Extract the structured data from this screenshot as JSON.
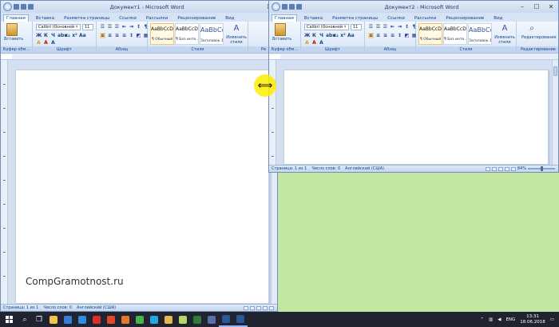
{
  "windows": [
    {
      "id": "w1",
      "title": "Документ1 - Microsoft Word",
      "tabs": [
        "Главная",
        "Вставка",
        "Разметка страницы",
        "Ссылки",
        "Рассылки",
        "Рецензирование",
        "Вид"
      ],
      "groups": {
        "clipboard": "Буфер обм...",
        "font": "Шрифт",
        "paragraph": "Абзац",
        "styles": "Стили",
        "editing": "Ре"
      },
      "paste_label": "Вставить",
      "font_name": "Calibri (Основной т",
      "font_size": "11",
      "styles": [
        {
          "sample": "AaBbCcDd",
          "name": "¶ Обычный"
        },
        {
          "sample": "AaBbCcDd",
          "name": "¶ Без инте..."
        },
        {
          "sample": "AaBbCc",
          "name": "Заголовок 1"
        }
      ],
      "change_styles": "Изменить стили",
      "status": {
        "page": "Страница: 1 из 1",
        "words": "Число слов: 0",
        "language": "Английский (США)"
      }
    },
    {
      "id": "w2",
      "title": "Документ2 - Microsoft Word",
      "tabs": [
        "Главная",
        "Вставка",
        "Разметка страницы",
        "Ссылки",
        "Рассылки",
        "Рецензирование",
        "Вид"
      ],
      "groups": {
        "clipboard": "Буфер обм...",
        "font": "Шрифт",
        "paragraph": "Абзац",
        "styles": "Стили",
        "editing": "Редактирование"
      },
      "paste_label": "Вставить",
      "font_name": "Calibri (Основной т",
      "font_size": "11",
      "styles": [
        {
          "sample": "AaBbCcDd",
          "name": "¶ Обычный"
        },
        {
          "sample": "AaBbCcDd",
          "name": "¶ Без инте..."
        },
        {
          "sample": "AaBbCc",
          "name": "Заголовок 1"
        }
      ],
      "change_styles": "Изменить стили",
      "editing_label": "Редактирование",
      "status": {
        "page": "Страница: 1 из 1",
        "words": "Число слов: 0",
        "language": "Английский (США)",
        "zoom": "84%"
      }
    }
  ],
  "font_buttons": [
    "Ж",
    "К",
    "Ч",
    "abe",
    "x₂",
    "x²",
    "Aa",
    "A",
    "A",
    "A"
  ],
  "watermark": "CompGramotnost.ru",
  "taskbar": {
    "apps": [
      {
        "icon": "search-icon",
        "glyph": "⌕"
      },
      {
        "icon": "task-view-icon",
        "glyph": "❐"
      },
      {
        "icon": "folder-icon",
        "color": "#f2c14e"
      },
      {
        "icon": "store-icon",
        "color": "#3a7bd5"
      },
      {
        "icon": "edge-icon",
        "color": "#2f8ce0"
      },
      {
        "icon": "opera-icon",
        "color": "#d9302c"
      },
      {
        "icon": "yandex-icon",
        "color": "#e5472e"
      },
      {
        "icon": "firefox-icon",
        "color": "#e8772e"
      },
      {
        "icon": "chrome-icon",
        "color": "#4caf50"
      },
      {
        "icon": "skype-icon",
        "color": "#23a7e0"
      },
      {
        "icon": "explorer-icon",
        "color": "#e6b94a"
      },
      {
        "icon": "paint-icon",
        "color": "#b5d86a"
      },
      {
        "icon": "camtasia-icon",
        "color": "#2e7d32"
      },
      {
        "icon": "mail-icon",
        "color": "#5a6ea8"
      },
      {
        "icon": "word-doc1-icon",
        "color": "#2b5797"
      },
      {
        "icon": "word-doc2-icon",
        "color": "#2b5797"
      }
    ],
    "lang": "ENG",
    "time": "13:31",
    "date": "18.06.2018"
  },
  "colors": {
    "ribbon": "#d8e5f6",
    "desktop": "#c3e6a3",
    "taskbar": "#1f2430",
    "highlight": "#ffec00"
  }
}
